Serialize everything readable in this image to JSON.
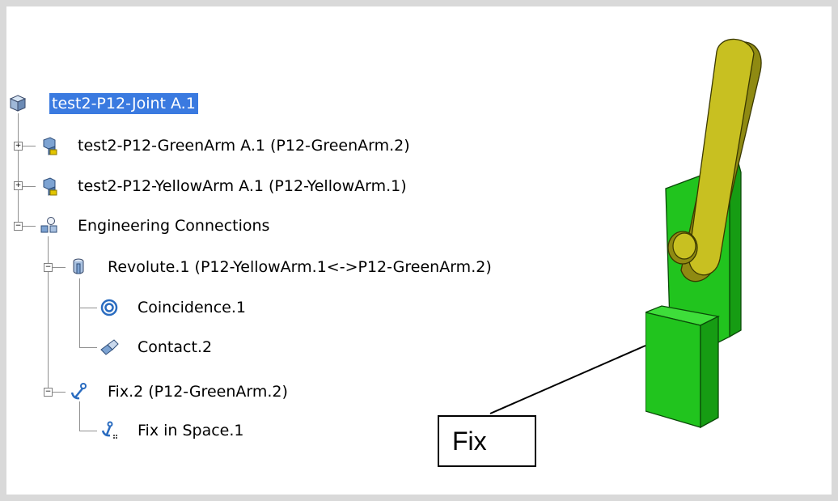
{
  "tree": {
    "root": {
      "label": "test2-P12-Joint A.1",
      "icon": "product-icon"
    },
    "children": [
      {
        "label": "test2-P12-GreenArm A.1 (P12-GreenArm.2)",
        "icon": "part-instance-icon"
      },
      {
        "label": "test2-P12-YellowArm A.1 (P12-YellowArm.1)",
        "icon": "part-instance-icon"
      },
      {
        "label": "Engineering Connections",
        "icon": "engineering-connections-icon"
      }
    ],
    "connections": [
      {
        "label": "Revolute.1 (P12-YellowArm.1<->P12-GreenArm.2)",
        "icon": "revolute-icon",
        "constraints": [
          {
            "label": "Coincidence.1",
            "icon": "coincidence-icon"
          },
          {
            "label": "Contact.2",
            "icon": "contact-icon"
          }
        ]
      },
      {
        "label": "Fix.2 (P12-GreenArm.2)",
        "icon": "fix-icon",
        "constraints": [
          {
            "label": "Fix in Space.1",
            "icon": "fix-in-space-icon"
          }
        ]
      }
    ]
  },
  "callout": {
    "label": "Fix"
  },
  "colors": {
    "selection": "#3a7ae0",
    "yellow_arm": "#c8c021",
    "green_arm": "#21c41e"
  }
}
